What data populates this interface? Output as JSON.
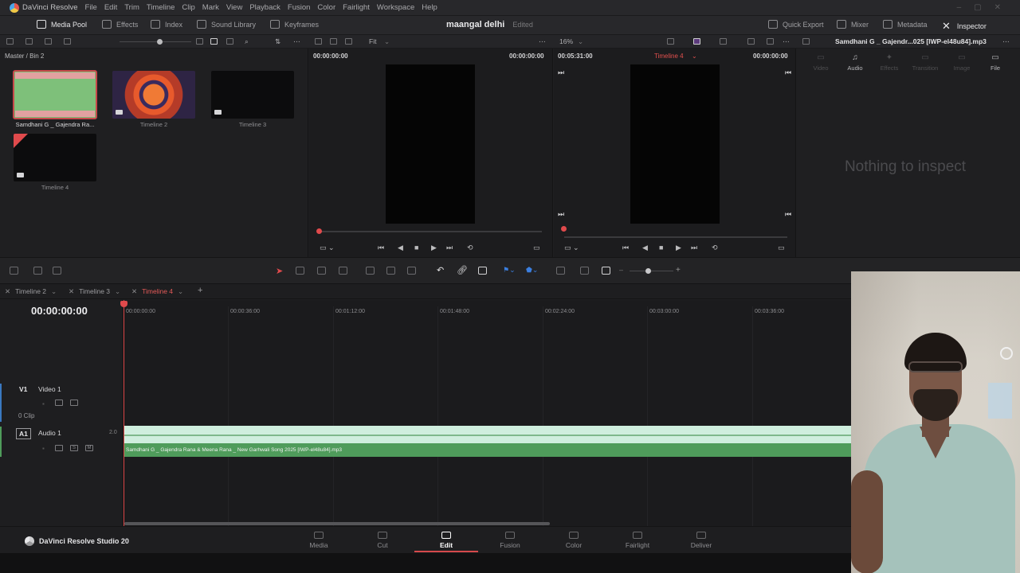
{
  "menubar": {
    "app_name": "DaVinci Resolve",
    "items": [
      "File",
      "Edit",
      "Trim",
      "Timeline",
      "Clip",
      "Mark",
      "View",
      "Playback",
      "Fusion",
      "Color",
      "Fairlight",
      "Workspace",
      "Help"
    ]
  },
  "toolbar": {
    "media_pool": "Media Pool",
    "effects": "Effects",
    "index": "Index",
    "sound_library": "Sound Library",
    "keyframes": "Keyframes",
    "project_name": "maangal delhi",
    "project_status": "Edited",
    "quick_export": "Quick Export",
    "mixer": "Mixer",
    "metadata": "Metadata",
    "inspector": "Inspector"
  },
  "subbar": {
    "fit": "Fit",
    "zoom": "16%",
    "clip_title": "Samdhani G _ Gajendr...025 [IWP-el48u84].mp3"
  },
  "media_pool": {
    "breadcrumb": "Master / Bin 2",
    "clips": [
      {
        "label": "Samdhani G _ Gajendra Ra..."
      },
      {
        "label": "Timeline 2"
      },
      {
        "label": "Timeline 3"
      },
      {
        "label": "Timeline 4"
      }
    ]
  },
  "source_viewer": {
    "timecode_left": "00:00:00:00",
    "timecode_right": "00:00:00:00"
  },
  "timeline_viewer": {
    "duration": "00:05:31:00",
    "timeline_name": "Timeline 4",
    "timecode": "00:00:00:00"
  },
  "inspector": {
    "tabs": [
      "Video",
      "Audio",
      "Effects",
      "Transition",
      "Image",
      "File"
    ],
    "empty_message": "Nothing to inspect"
  },
  "timeline": {
    "tabs": [
      "Timeline 2",
      "Timeline 3",
      "Timeline 4"
    ],
    "current_timecode": "00:00:00:00",
    "ruler": [
      "00:00:00:00",
      "00:00:36:00",
      "00:01:12:00",
      "00:01:48:00",
      "00:02:24:00",
      "00:03:00:00",
      "00:03:36:00"
    ],
    "video_track": {
      "id": "V1",
      "name": "Video 1",
      "clip_count": "0 Clip"
    },
    "audio_track": {
      "id": "A1",
      "name": "Audio 1",
      "level": "2.0"
    },
    "audio_clip_label": "Samdhani G _ Gajendra Rana & Meena Rana _ New Garhwali Song 2025 [IWP-el48u84].mp3"
  },
  "pagebar": {
    "brand": "DaVinci Resolve Studio 20",
    "pages": [
      "Media",
      "Cut",
      "Edit",
      "Fusion",
      "Color",
      "Fairlight",
      "Deliver"
    ],
    "active_page": "Edit"
  },
  "colors": {
    "accent_red": "#e04a4c",
    "audio_clip_green": "#4f9c5b",
    "background": "#1f1f21"
  }
}
